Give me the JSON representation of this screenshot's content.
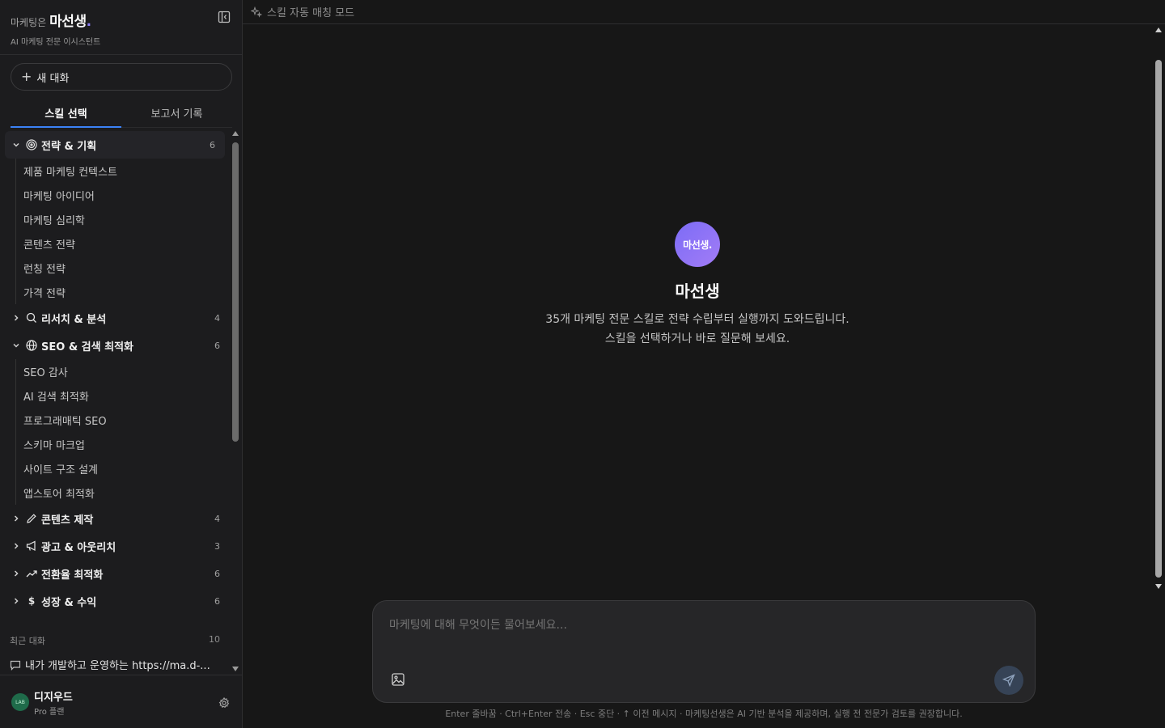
{
  "brand": {
    "prefix": "마케팅은",
    "name": "마선생",
    "dot": ".",
    "subtitle": "AI 마케팅 전문 이시스턴트"
  },
  "sidebar": {
    "new_chat_label": "새 대화",
    "tabs": [
      {
        "label": "스킬 선택",
        "active": true
      },
      {
        "label": "보고서 기록",
        "active": false
      }
    ],
    "categories": [
      {
        "label": "전략 & 기획",
        "icon": "target-icon",
        "count": "6",
        "expanded": true,
        "items": [
          "제품 마케팅 컨텍스트",
          "마케팅 아이디어",
          "마케팅 심리학",
          "콘텐츠 전략",
          "런칭 전략",
          "가격 전략"
        ]
      },
      {
        "label": "리서치 & 분석",
        "icon": "search-icon",
        "count": "4",
        "expanded": false,
        "items": []
      },
      {
        "label": "SEO & 검색 최적화",
        "icon": "globe-icon",
        "count": "6",
        "expanded": true,
        "items": [
          "SEO 감사",
          "AI 검색 최적화",
          "프로그래매틱 SEO",
          "스키마 마크업",
          "사이트 구조 설계",
          "앱스토어 최적화"
        ]
      },
      {
        "label": "콘텐츠 제작",
        "icon": "pencil-icon",
        "count": "4",
        "expanded": false,
        "items": []
      },
      {
        "label": "광고 & 아웃리치",
        "icon": "megaphone-icon",
        "count": "3",
        "expanded": false,
        "items": []
      },
      {
        "label": "전환율 최적화",
        "icon": "trending-up-icon",
        "count": "6",
        "expanded": false,
        "items": []
      },
      {
        "label": "성장 & 수익",
        "icon": "dollar-icon",
        "count": "6",
        "expanded": false,
        "items": []
      }
    ],
    "recent": {
      "label": "최근 대화",
      "count": "10",
      "items": [
        "내가 개발하고 운영하는 https://ma.d-..."
      ]
    },
    "user": {
      "name": "디지우드",
      "plan": "Pro 플랜",
      "avatar_text": "LAB"
    }
  },
  "main": {
    "topbar_label": "스킬 자동 매칭 모드",
    "hero": {
      "logo_text": "마선생.",
      "title": "마선생",
      "desc_line1": "35개 마케팅 전문 스킬로 전략 수립부터 실행까지 도와드립니다.",
      "desc_line2": "스킬을 선택하거나 바로 질문해 보세요."
    },
    "composer": {
      "placeholder": "마케팅에 대해 무엇이든 물어보세요...",
      "footnote": "Enter 줄바꿈 · Ctrl+Enter 전송 · Esc 중단 · ↑ 이전 메시지 · 마케팅선생은 AI 기반 분석을 제공하며, 실행 전 전문가 검토를 권장합니다."
    }
  },
  "colors": {
    "accent": "#3b82f6",
    "brand_purple": "#8b7cf6",
    "background": "#171717",
    "sidebar": "#1c1c1e"
  }
}
